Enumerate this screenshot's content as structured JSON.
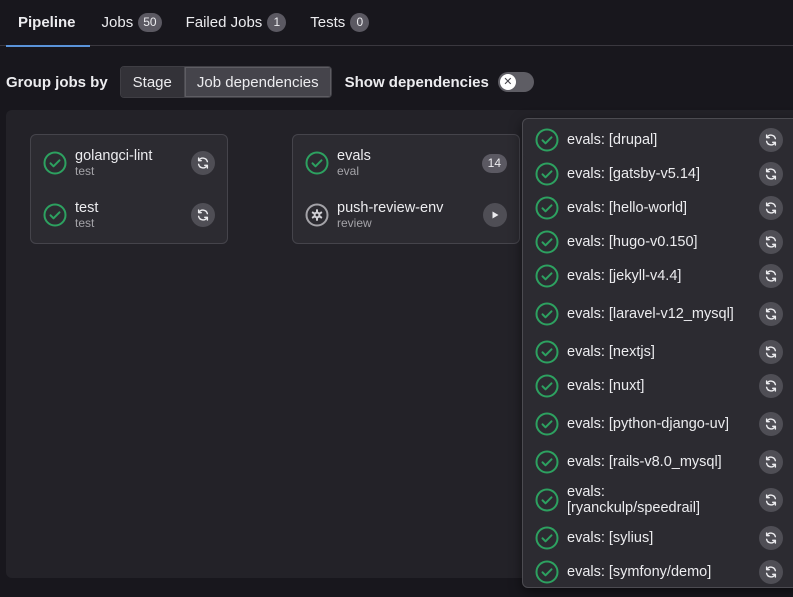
{
  "tabs": [
    {
      "label": "Pipeline",
      "active": true
    },
    {
      "label": "Jobs",
      "count": "50"
    },
    {
      "label": "Failed Jobs",
      "count": "1"
    },
    {
      "label": "Tests",
      "count": "0"
    }
  ],
  "controls": {
    "group_label": "Group jobs by",
    "options": [
      "Stage",
      "Job dependencies"
    ],
    "selected": "Job dependencies",
    "show_deps_label": "Show dependencies",
    "show_deps_on": false
  },
  "stages": [
    {
      "jobs": [
        {
          "name": "golangci-lint",
          "stage": "test",
          "status": "success",
          "action": "retry"
        },
        {
          "name": "test",
          "stage": "test",
          "status": "success",
          "action": "retry"
        }
      ]
    },
    {
      "jobs": [
        {
          "name": "evals",
          "stage": "eval",
          "status": "success",
          "count": "14"
        },
        {
          "name": "push-review-env",
          "stage": "review",
          "status": "manual",
          "action": "play"
        }
      ]
    }
  ],
  "dropdown": {
    "items": [
      {
        "label": "evals: [drupal]"
      },
      {
        "label": "evals: [gatsby-v5.14]"
      },
      {
        "label": "evals: [hello-world]"
      },
      {
        "label": "evals: [hugo-v0.150]"
      },
      {
        "label": "evals: [jekyll-v4.4]"
      },
      {
        "label": "evals: [laravel-v12_mysql]"
      },
      {
        "label": "evals: [nextjs]"
      },
      {
        "label": "evals: [nuxt]"
      },
      {
        "label": "evals: [python-django-uv]"
      },
      {
        "label": "evals: [rails-v8.0_mysql]"
      },
      {
        "label": "evals: [ryanckulp/speedrail]"
      },
      {
        "label": "evals: [sylius]"
      },
      {
        "label": "evals: [symfony/demo]"
      }
    ]
  },
  "colors": {
    "success": "#2da160",
    "accent": "#5a93d9"
  },
  "icons": {
    "success": "check-circle-icon",
    "manual": "gear-icon",
    "retry": "retry-icon",
    "play": "play-icon"
  }
}
